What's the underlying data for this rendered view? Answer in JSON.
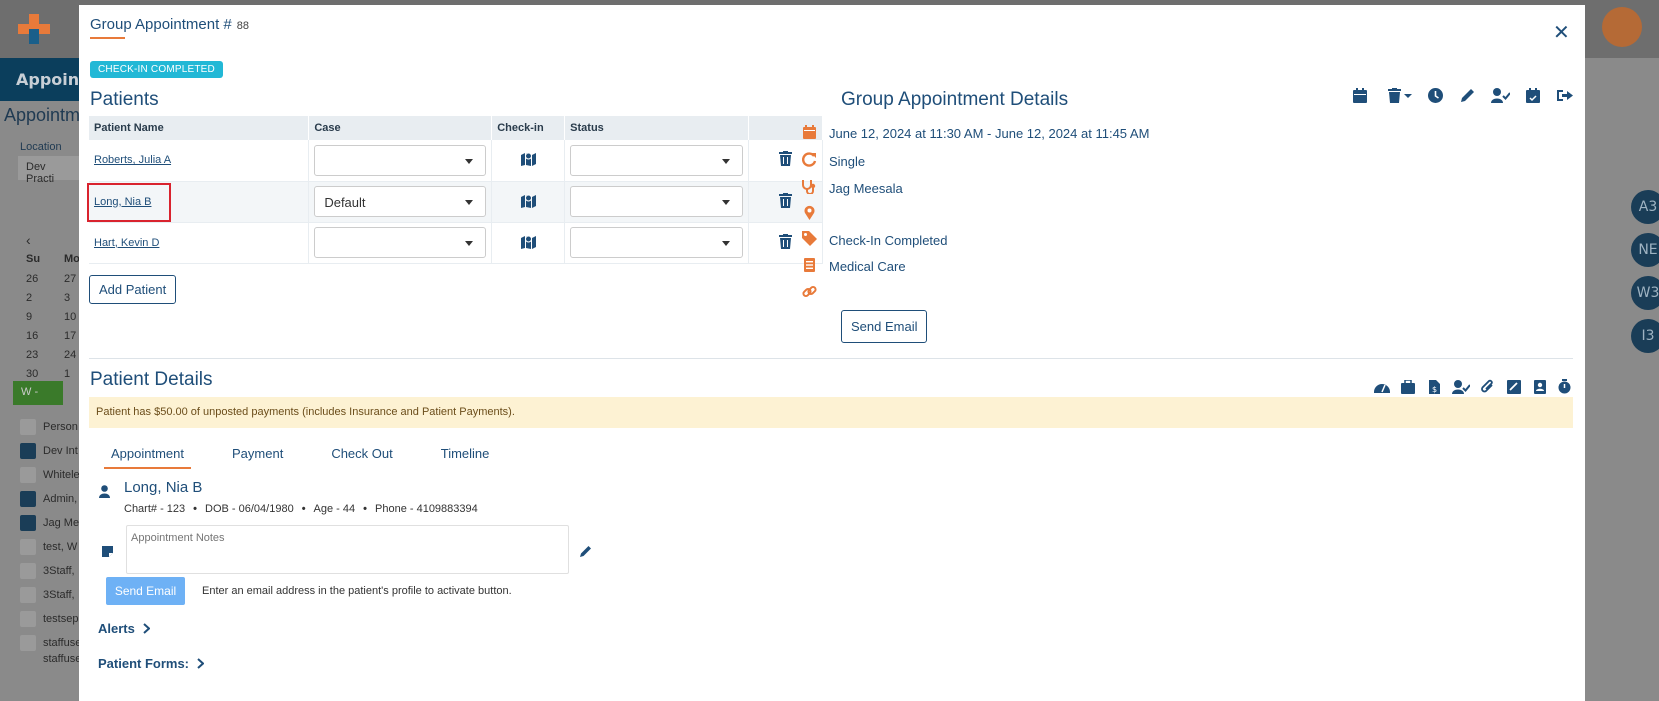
{
  "background": {
    "nav_label": "Appoint",
    "section_title": "Appointm",
    "location_label": "Location",
    "location_value": "Dev Practi",
    "weekdays": [
      "Su",
      "Mo"
    ],
    "calendar_rows": [
      [
        "26",
        "27"
      ],
      [
        "2",
        "3"
      ],
      [
        "9",
        "10"
      ],
      [
        "16",
        "17"
      ],
      [
        "23",
        "24"
      ],
      [
        "30",
        "1"
      ]
    ],
    "view_button": "W -",
    "people": [
      "Person",
      "Dev Int",
      "Whitele",
      "Admin,",
      "Jag Me",
      "test, W",
      "3Staff,",
      "3Staff,",
      "testsep",
      "staffuse",
      "staffuse"
    ],
    "bubbles": [
      "A3",
      "NE",
      "W3",
      "I3"
    ]
  },
  "modal": {
    "title": "Group Appointment #",
    "number": "88",
    "status_badge": "CHECK-IN COMPLETED"
  },
  "patients": {
    "heading": "Patients",
    "columns": [
      "Patient Name",
      "Case",
      "Check-in",
      "Status"
    ],
    "rows": [
      {
        "name": "Roberts, Julia A",
        "case": "",
        "status": ""
      },
      {
        "name": "Long, Nia B",
        "case": "Default",
        "status": ""
      },
      {
        "name": "Hart, Kevin D",
        "case": "",
        "status": ""
      }
    ],
    "add_button": "Add Patient"
  },
  "details": {
    "heading": "Group Appointment Details",
    "date_range": "June 12, 2024 at 11:30 AM - June 12, 2024 at 11:45 AM",
    "recurrence": "Single",
    "provider": "Jag Meesala",
    "location": "",
    "status": "Check-In Completed",
    "type": "Medical Care",
    "link": "",
    "send_email": "Send Email"
  },
  "patient_details": {
    "heading": "Patient Details",
    "warning": "Patient has $50.00 of unposted payments (includes Insurance and Patient Payments).",
    "tabs": [
      "Appointment",
      "Payment",
      "Check Out",
      "Timeline"
    ],
    "name": "Long, Nia B",
    "chart": "Chart# - 123",
    "dob": "DOB - 06/04/1980",
    "age": "Age - 44",
    "phone": "Phone - 4109883394",
    "notes_placeholder": "Appointment Notes",
    "send_email": "Send Email",
    "email_hint": "Enter an email address in the patient's profile to activate button.",
    "alerts": "Alerts",
    "forms": "Patient Forms:"
  },
  "colors": {
    "accent": "#e87a3a",
    "primary": "#1f4e79",
    "badge": "#22b8d6",
    "highlight": "#d9232e"
  }
}
